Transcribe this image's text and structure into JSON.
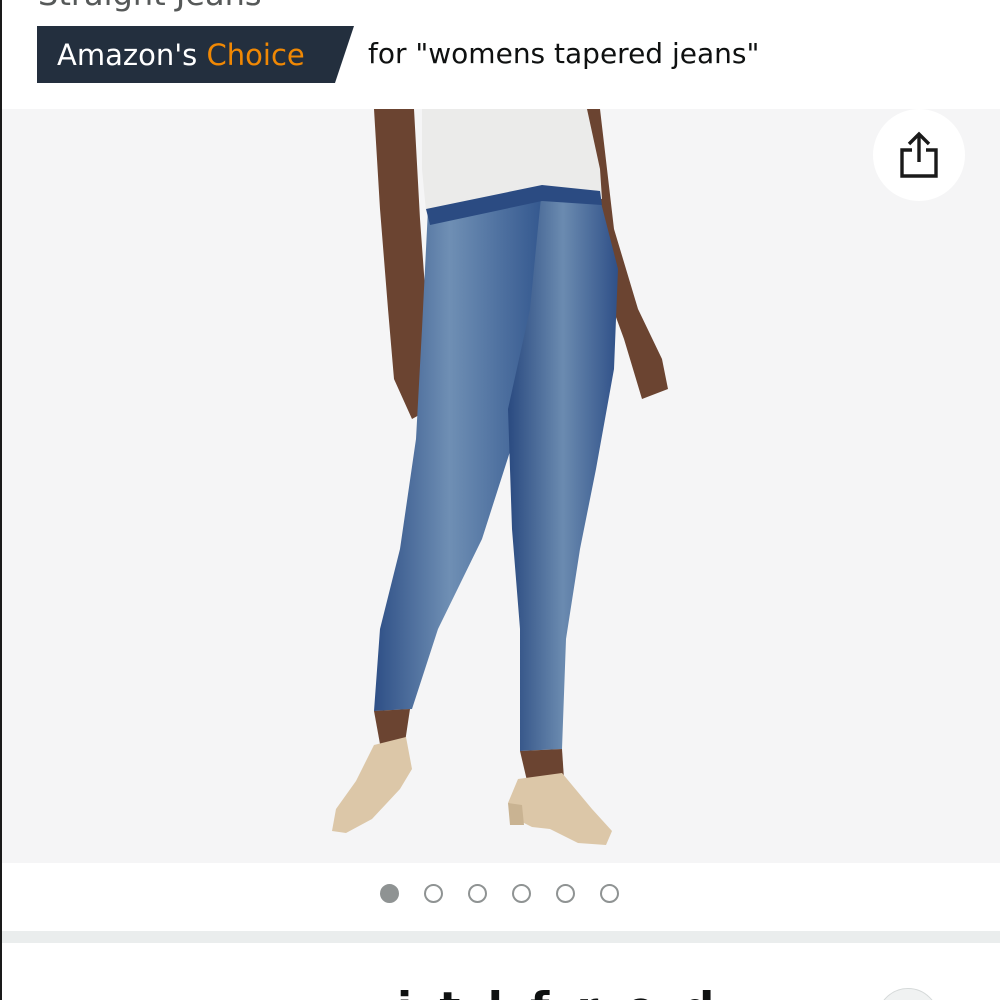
{
  "product": {
    "title_fragment": "Straight Jeans"
  },
  "badge": {
    "label_prefix": "Amazon's",
    "label_accent": "Choice",
    "query_text": "for \"womens tapered jeans\"",
    "background_color": "#232f3e",
    "accent_color": "#f08804"
  },
  "gallery": {
    "image_subject": "model wearing blue skinny jeans, white t-shirt and beige heels",
    "share_icon": "share-icon",
    "image_count": 6,
    "active_index": 0
  },
  "below_fold": {
    "peek_text": "i   t   l   f   r   e   d"
  }
}
